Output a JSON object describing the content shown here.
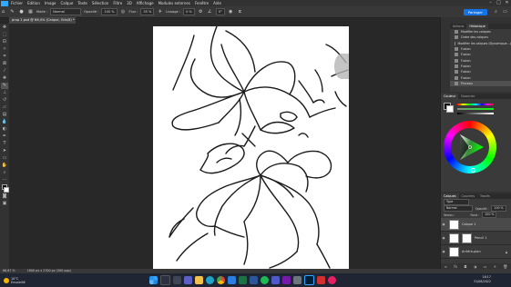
{
  "app": {
    "logo": "Ps"
  },
  "menu": [
    "Fichier",
    "Edition",
    "Image",
    "Calque",
    "Texte",
    "Sélection",
    "Filtre",
    "3D",
    "Affichage",
    "Modules externes",
    "Fenêtre",
    "Aide"
  ],
  "window_controls": [
    "–",
    "□",
    "✕"
  ],
  "options": {
    "mode_label": "Mode :",
    "mode_value": "Normal",
    "opacity_label": "Opacité :",
    "opacity_value": "100 %",
    "flow_label": "Flux :",
    "flow_value": "35 %",
    "smoothing_label": "Lissage :",
    "smoothing_value": "0 %",
    "angle_value": "0°",
    "share_label": "Partager"
  },
  "doc_tab": "prop 1.psd @ 66,4% (Calque, Gris/8) *",
  "tools": [
    "move",
    "marquee",
    "lasso",
    "wand",
    "crop",
    "frame",
    "eyedropper",
    "heal",
    "brush",
    "stamp",
    "history-brush",
    "eraser",
    "gradient",
    "blur",
    "dodge",
    "pen",
    "type",
    "path-select",
    "rectangle",
    "hand",
    "zoom",
    "more",
    "fg-bg",
    "quick-mask",
    "screen-mode"
  ],
  "panels": {
    "history_tabs": [
      "Actions",
      "Historique"
    ],
    "history_items": [
      "Modifier les calques",
      "Ordre des calques",
      "Modifier les calques (Dynamique...)",
      "Fusion",
      "Fusion",
      "Fusion",
      "Fusion",
      "Fusion",
      "Fusion",
      "Pinceau"
    ],
    "color_tabs": [
      "Couleur",
      "Nuancier"
    ],
    "layers_tabs": [
      "Calques",
      "Couches",
      "Tracés"
    ],
    "layers_kind": "Type",
    "blend_mode": "Normal",
    "opacity_label": "Opacité :",
    "opacity_value": "100 %",
    "lock_label": "Verrou :",
    "fill_label": "Fond :",
    "fill_value": "100 %",
    "layers": [
      {
        "name": "Calque 1"
      },
      {
        "name": "Pencil 1"
      },
      {
        "name": "Arrière-plan"
      }
    ]
  },
  "status": {
    "zoom": "66,67 %",
    "doc": "1800 px x 2700 px (300 ppp)"
  },
  "taskbar": {
    "weather_temp": "10°C",
    "weather_desc": "Ensoleillé",
    "time": "16:17",
    "date": "31/08/2022"
  },
  "colors": {
    "accent": "#1473e6",
    "ps_blue": "#31a8ff"
  }
}
